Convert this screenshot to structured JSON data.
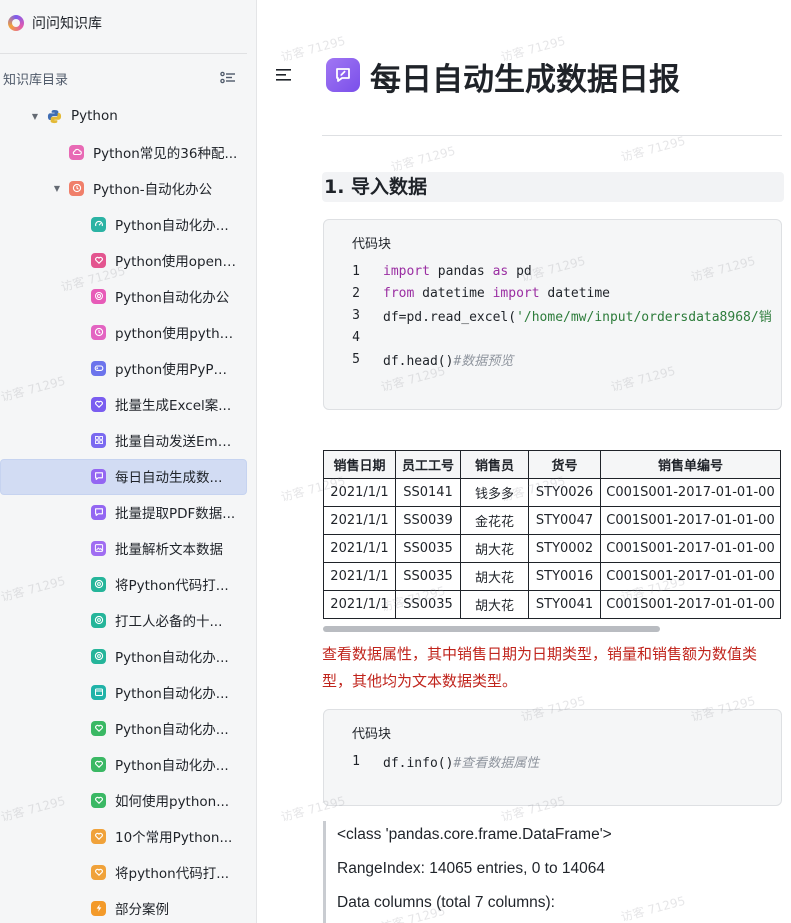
{
  "app": {
    "name": "问问知识库"
  },
  "sidebar": {
    "directory_title": "知识库目录",
    "root": {
      "label": "Python",
      "icon": "python-icon"
    },
    "level1": [
      {
        "label": "Python常见的36种配...",
        "icon": "cloud-icon",
        "color": "#e86ab5"
      },
      {
        "label": "Python-自动化办公",
        "icon": "clock-icon",
        "color": "#f07f6a"
      }
    ],
    "level2": [
      {
        "label": "Python自动化办...",
        "icon": "gauge-icon",
        "color": "#2bb3a4"
      },
      {
        "label": "Python使用openp...",
        "icon": "heart-icon",
        "color": "#e3558f"
      },
      {
        "label": "Python自动化办公",
        "icon": "target-icon",
        "color": "#e75bb8"
      },
      {
        "label": "python使用pytho...",
        "icon": "clock-icon",
        "color": "#e364c2"
      },
      {
        "label": "python使用PyPDF...",
        "icon": "gamepad-icon",
        "color": "#6c74ec"
      },
      {
        "label": "批量生成Excel案...",
        "icon": "heart-icon",
        "color": "#7a5df0"
      },
      {
        "label": "批量自动发送Ema...",
        "icon": "grid-icon",
        "color": "#7a69f0"
      },
      {
        "label": "每日自动生成数...",
        "icon": "chat-icon",
        "color": "#9366f2",
        "active": true
      },
      {
        "label": "批量提取PDF数据...",
        "icon": "chat-icon",
        "color": "#9366f2"
      },
      {
        "label": "批量解析文本数据",
        "icon": "image-icon",
        "color": "#a06df2"
      },
      {
        "label": "将Python代码打...",
        "icon": "support-icon",
        "color": "#25b59a"
      },
      {
        "label": "打工人必备的十...",
        "icon": "support-icon",
        "color": "#25b59a"
      },
      {
        "label": "Python自动化办...",
        "icon": "support-icon",
        "color": "#25b59a"
      },
      {
        "label": "Python自动化办...",
        "icon": "calendar-icon",
        "color": "#20b3a8"
      },
      {
        "label": "Python自动化办...",
        "icon": "heart-icon",
        "color": "#3ab864"
      },
      {
        "label": "Python自动化办...",
        "icon": "heart-icon",
        "color": "#3ab864"
      },
      {
        "label": "如何使用python...",
        "icon": "heart-icon",
        "color": "#3ab864"
      },
      {
        "label": "10个常用Python...",
        "icon": "heart-icon",
        "color": "#f0a23a"
      },
      {
        "label": "将python代码打...",
        "icon": "heart-icon",
        "color": "#f0a23a"
      },
      {
        "label": "部分案例",
        "icon": "lightning-icon",
        "color": "#f39a2a"
      }
    ]
  },
  "doc": {
    "title": "每日自动生成数据日报",
    "section1": "1. 导入数据",
    "codeblock_label": "代码块",
    "code1": {
      "line_numbers": [
        "1",
        "2",
        "3",
        "4",
        "5"
      ],
      "l1_kw1": "import",
      "l1_mid": " pandas ",
      "l1_kw2": "as",
      "l1_end": " pd",
      "l2_kw1": "from",
      "l2_mid": " datetime ",
      "l2_kw2": "import",
      "l2_end": " datetime",
      "l3_pre": "df=pd.read_excel(",
      "l3_str": "'/home/mw/input/ordersdata8968/销",
      "l5_code": "df.head()",
      "l5_comment": "#数据预览"
    },
    "table": {
      "headers": [
        "销售日期",
        "员工工号",
        "销售员",
        "货号",
        "销售单编号"
      ],
      "rows": [
        [
          "2021/1/1",
          "SS0141",
          "钱多多",
          "STY0026",
          "C001S001-2017-01-01-00"
        ],
        [
          "2021/1/1",
          "SS0039",
          "金花花",
          "STY0047",
          "C001S001-2017-01-01-00"
        ],
        [
          "2021/1/1",
          "SS0035",
          "胡大花",
          "STY0002",
          "C001S001-2017-01-01-00"
        ],
        [
          "2021/1/1",
          "SS0035",
          "胡大花",
          "STY0016",
          "C001S001-2017-01-01-00"
        ],
        [
          "2021/1/1",
          "SS0035",
          "胡大花",
          "STY0041",
          "C001S001-2017-01-01-00"
        ]
      ]
    },
    "note": "查看数据属性，其中销售日期为日期类型，销量和销售额为数值类型，其他均为文本数据类型。",
    "code2": {
      "line_number": "1",
      "code": "df.info()",
      "comment": "#查看数据属性"
    },
    "output": [
      "<class 'pandas.core.frame.DataFrame'>",
      "RangeIndex: 14065 entries, 0 to 14064",
      "Data columns (total 7 columns):"
    ]
  },
  "watermark": "访客 71295"
}
